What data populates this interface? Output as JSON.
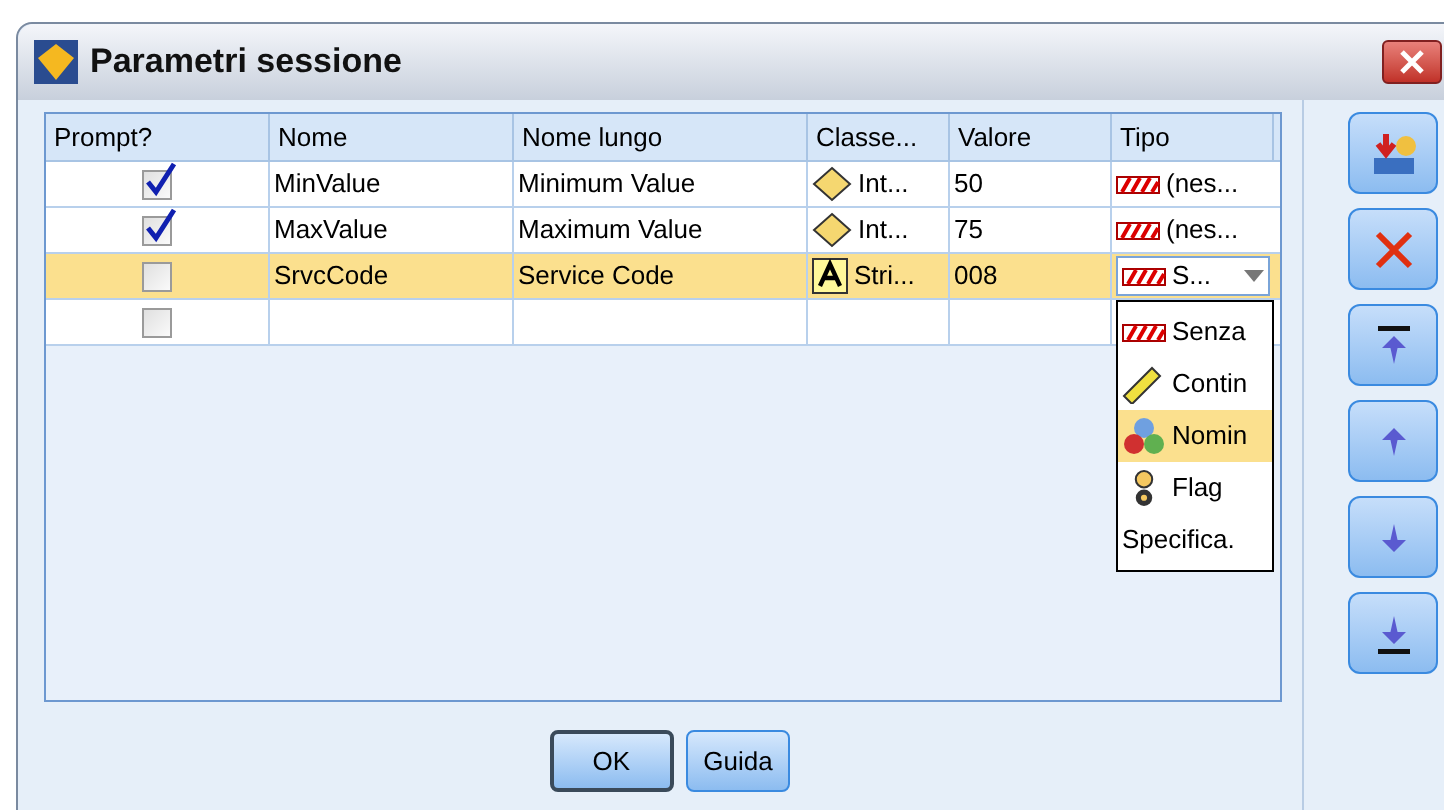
{
  "window": {
    "title": "Parametri sessione"
  },
  "table": {
    "columns": [
      "Prompt?",
      "Nome",
      "Nome lungo",
      "Classe...",
      "Valore",
      "Tipo"
    ],
    "rows": [
      {
        "prompt_checked": true,
        "name": "MinValue",
        "long_name": "Minimum Value",
        "class": {
          "kind": "integer",
          "label": "Int..."
        },
        "value": "50",
        "type": {
          "kind": "none",
          "label": "(nes..."
        },
        "selected": false
      },
      {
        "prompt_checked": true,
        "name": "MaxValue",
        "long_name": "Maximum Value",
        "class": {
          "kind": "integer",
          "label": "Int..."
        },
        "value": "75",
        "type": {
          "kind": "none",
          "label": "(nes..."
        },
        "selected": false
      },
      {
        "prompt_checked": false,
        "name": "SrvcCode",
        "long_name": "Service Code",
        "class": {
          "kind": "string",
          "label": "Stri..."
        },
        "value": "008",
        "type": {
          "kind": "none",
          "label": "S...",
          "open": true
        },
        "selected": true
      },
      {
        "prompt_checked": false,
        "selected": false
      }
    ]
  },
  "type_dropdown": {
    "items": [
      {
        "kind": "none",
        "label": "Senza",
        "selected": false
      },
      {
        "kind": "continuous",
        "label": "Contin",
        "selected": false
      },
      {
        "kind": "nominal",
        "label": "Nomin",
        "selected": true
      },
      {
        "kind": "flag",
        "label": "Flag",
        "selected": false
      },
      {
        "kind": "specify",
        "label": "Specifica.",
        "selected": false
      }
    ]
  },
  "toolbar": [
    {
      "kind": "import"
    },
    {
      "kind": "delete"
    },
    {
      "kind": "top"
    },
    {
      "kind": "up"
    },
    {
      "kind": "down"
    },
    {
      "kind": "bottom"
    }
  ],
  "buttons": [
    {
      "label": "OK",
      "default": true
    },
    {
      "label": "Guida",
      "default": false
    }
  ]
}
